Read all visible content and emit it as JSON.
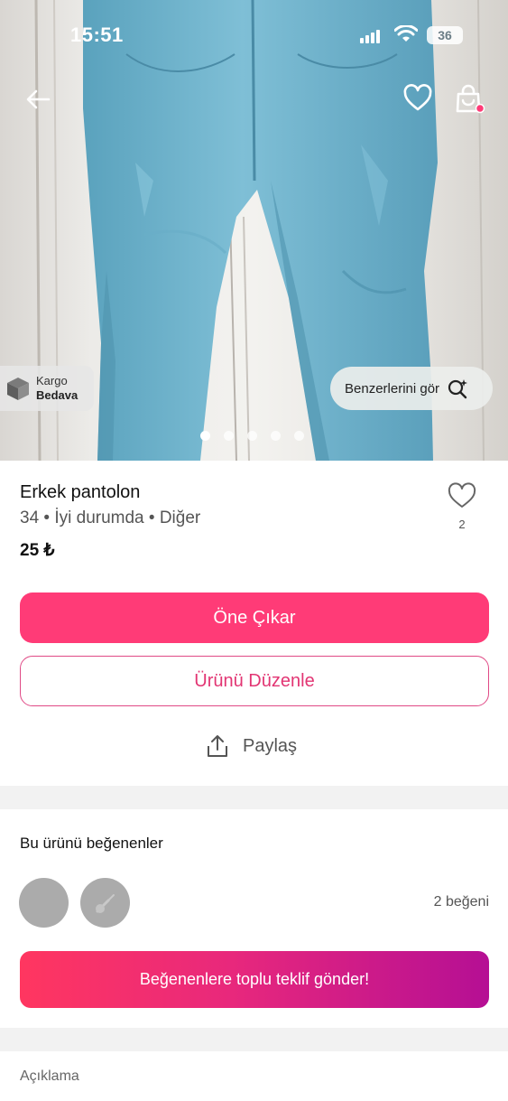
{
  "status_bar": {
    "time": "15:51",
    "battery": "36"
  },
  "hero": {
    "cargo_badge": {
      "line1": "Kargo",
      "line2": "Bedava"
    },
    "similar_button": "Benzerlerini gör",
    "image_count": 5,
    "active_image": 1
  },
  "product": {
    "title": "Erkek pantolon",
    "meta": "34 • İyi durumda • Diğer",
    "price": "25 ₺",
    "like_count": "2"
  },
  "actions": {
    "promote": "Öne Çıkar",
    "edit": "Ürünü Düzenle",
    "share": "Paylaş"
  },
  "likers": {
    "title": "Bu ürünü beğenenler",
    "total": "2 beğeni",
    "send_offer": "Beğenenlere toplu teklif gönder!"
  },
  "description": {
    "title": "Açıklama"
  },
  "colors": {
    "primary": "#ff3b77",
    "outline_text": "#e23573",
    "gradient_start": "#ff3660",
    "gradient_end": "#b50f94"
  },
  "icons": {
    "back": "arrow-left-icon",
    "favorite": "heart-icon",
    "bag": "shopping-bag-icon",
    "cargo": "box-icon",
    "similar": "search-sparkle-icon",
    "share": "share-icon"
  }
}
